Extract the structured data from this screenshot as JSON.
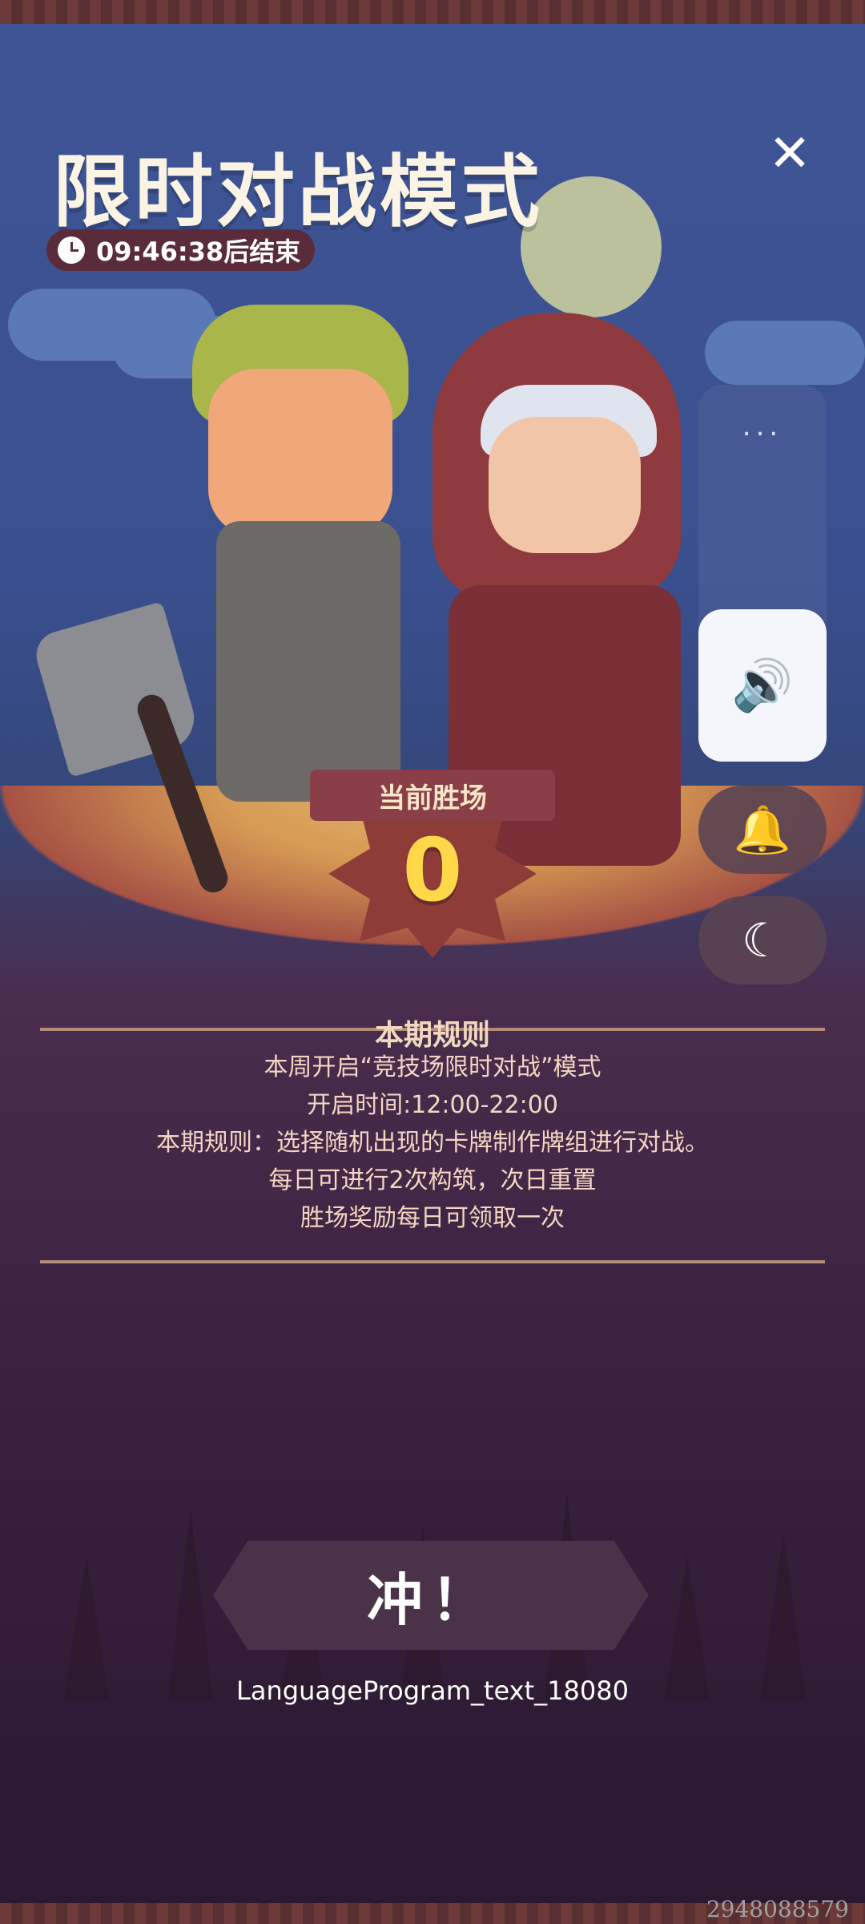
{
  "header": {
    "title": "限时对战模式",
    "timer": "09:46:38后结束",
    "close_icon": "close-icon"
  },
  "badge": {
    "label": "当前胜场",
    "count": "0"
  },
  "side_controls": {
    "dots": "...",
    "volume_icon": "volume-icon",
    "bell_icon": "bell-icon",
    "moon_icon": "moon-icon"
  },
  "rules": {
    "title": "本期规则",
    "lines": [
      "本周开启“竞技场限时对战”模式",
      "开启时间:12:00-22:00",
      "本期规则：选择随机出现的卡牌制作牌组进行对战。",
      "每日可进行2次构筑，次日重置",
      "胜场奖励每日可领取一次"
    ]
  },
  "actions": {
    "go_label": "冲！",
    "under_text": "LanguageProgram_text_18080"
  },
  "footer": {
    "corner_number": "2948088579"
  }
}
